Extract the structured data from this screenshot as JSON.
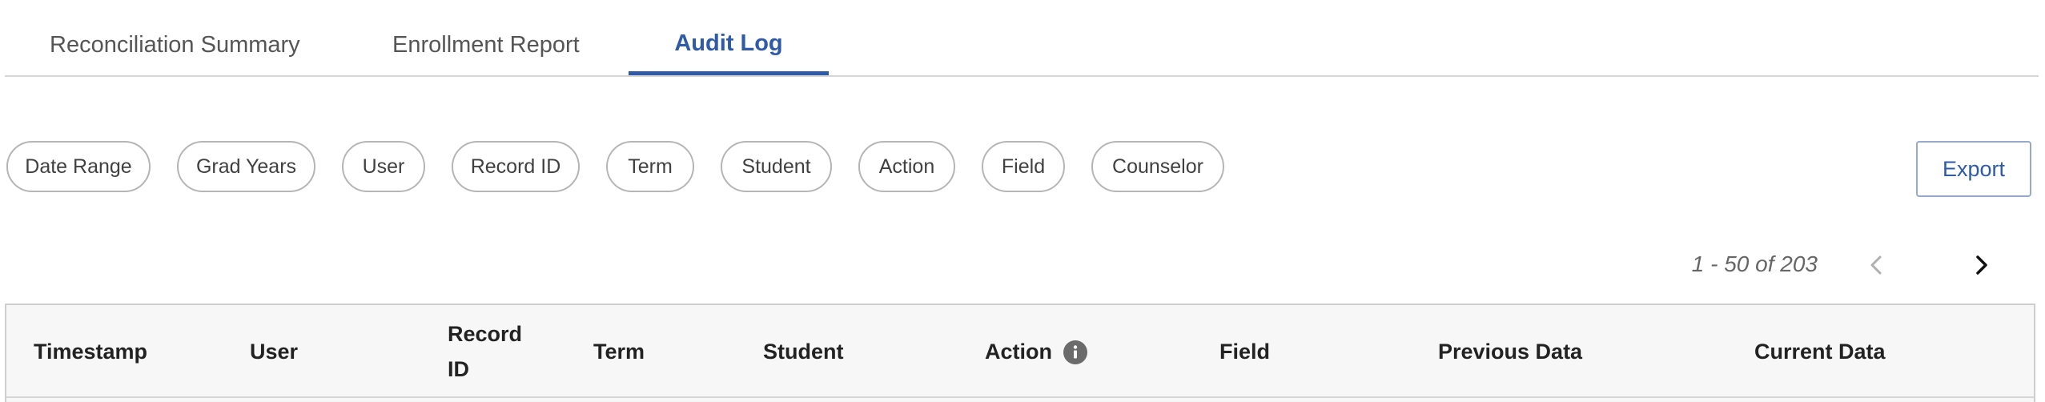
{
  "tabs": [
    {
      "label": "Reconciliation Summary",
      "active": false
    },
    {
      "label": "Enrollment Report",
      "active": false
    },
    {
      "label": "Audit Log",
      "active": true
    }
  ],
  "filters": [
    "Date Range",
    "Grad Years",
    "User",
    "Record ID",
    "Term",
    "Student",
    "Action",
    "Field",
    "Counselor"
  ],
  "export_label": "Export",
  "pagination": {
    "range_text": "1 - 50 of 203",
    "prev_icon": "chevron-left-icon",
    "next_icon": "chevron-right-icon",
    "prev_disabled": true
  },
  "table": {
    "columns": [
      "Timestamp",
      "User",
      "Record ID",
      "Term",
      "Student",
      "Action",
      "Field",
      "Previous Data",
      "Current Data"
    ],
    "action_info_icon": "info-icon"
  },
  "colors": {
    "accent": "#2f5aa8",
    "chip_border": "#b5b5b5",
    "header_bg": "#f7f7f7"
  }
}
